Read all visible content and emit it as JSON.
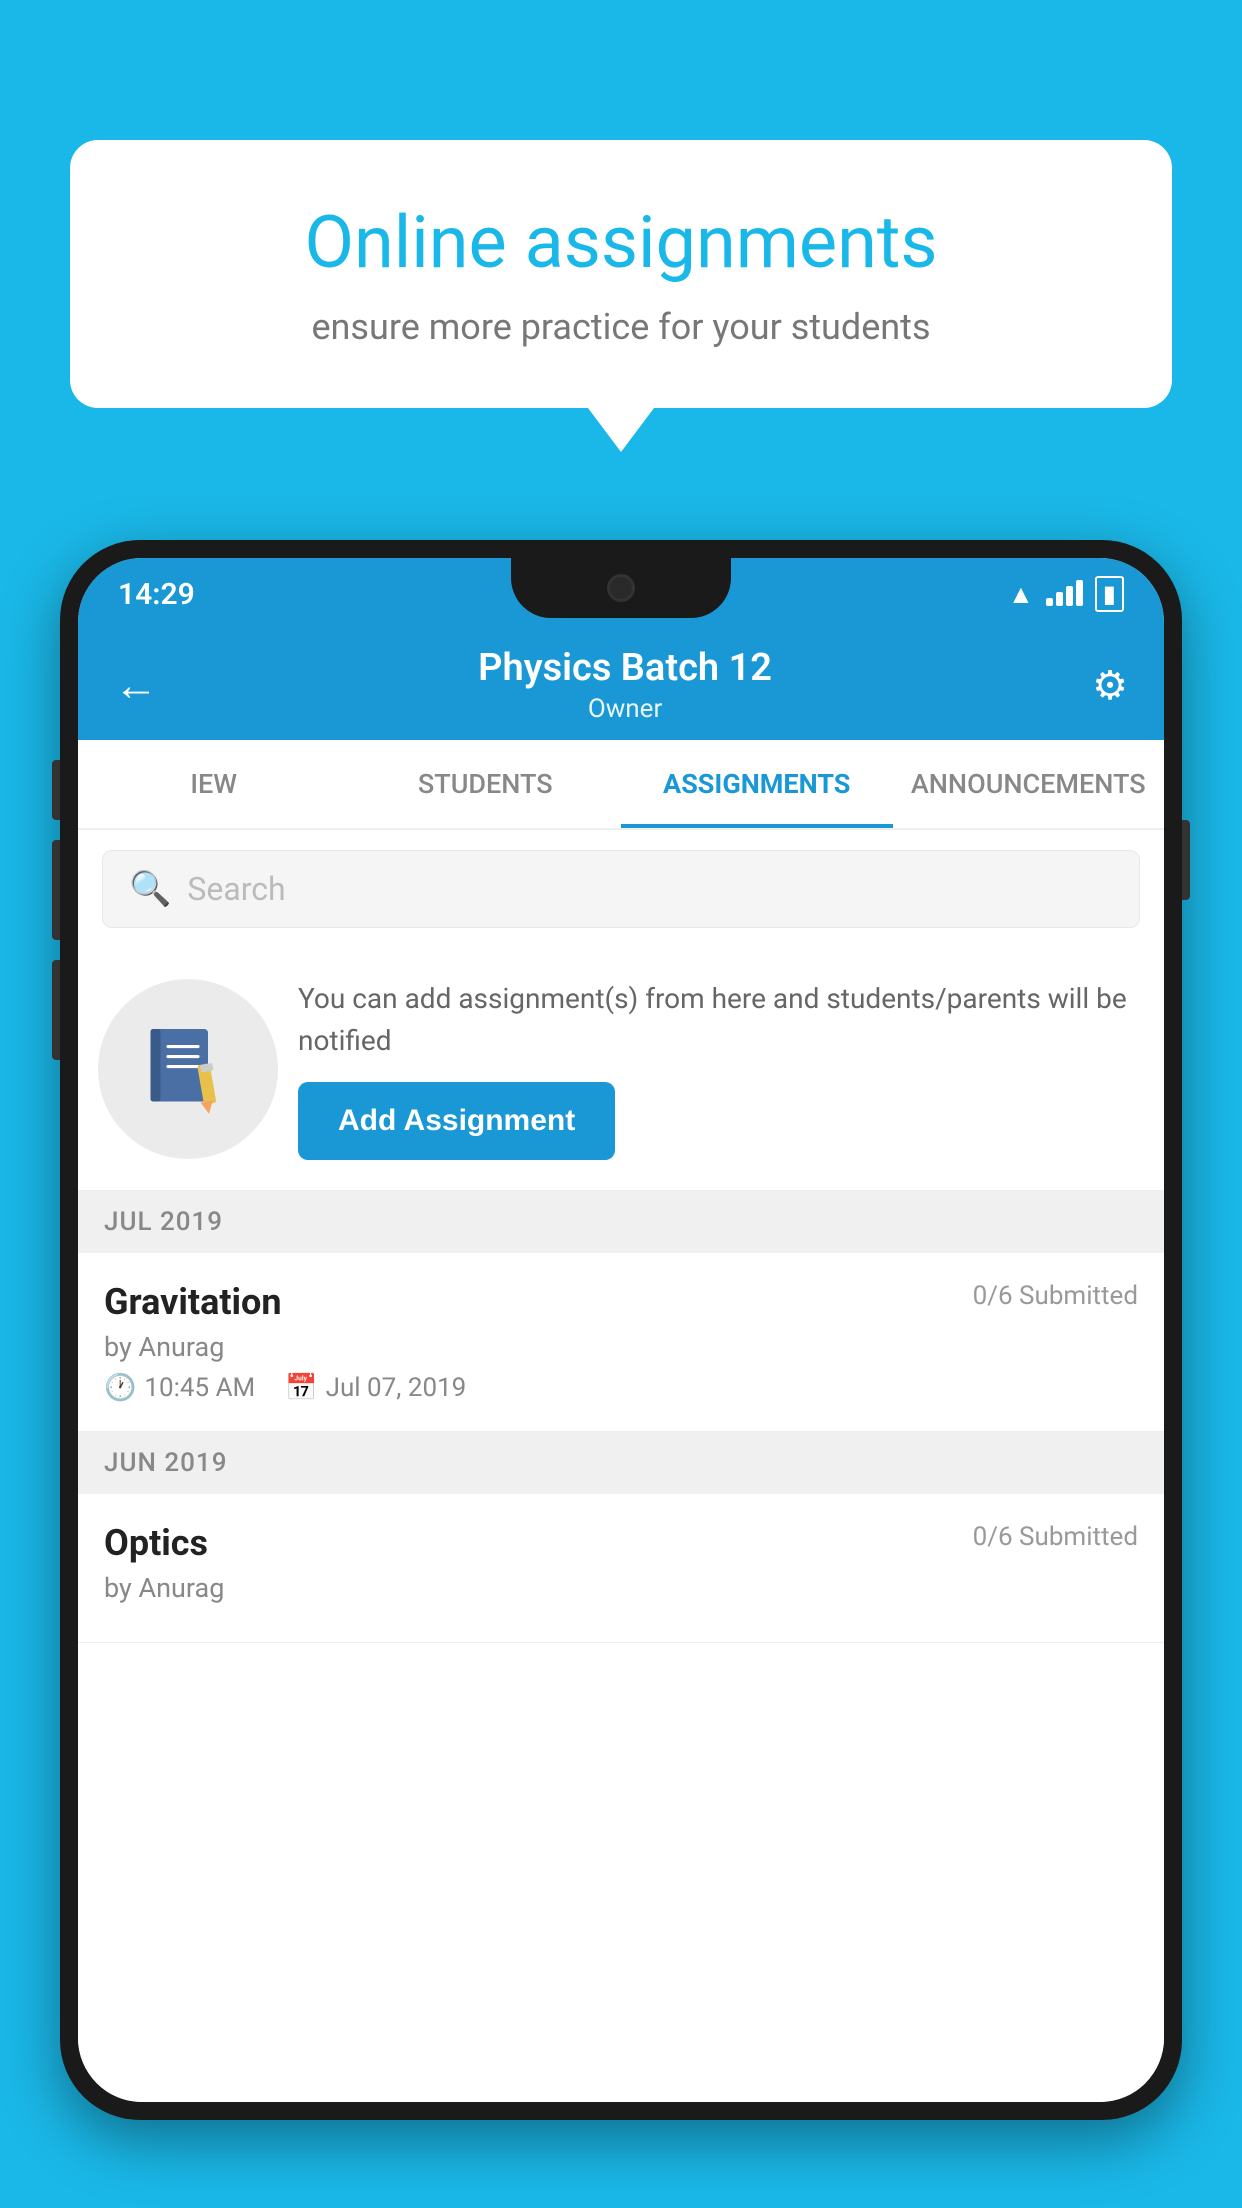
{
  "background_color": "#1ab8e8",
  "promo": {
    "headline": "Online assignments",
    "subtext": "ensure more practice for your students"
  },
  "phone": {
    "status_bar": {
      "time": "14:29",
      "wifi": "▲",
      "battery": "▮"
    },
    "header": {
      "title": "Physics Batch 12",
      "subtitle": "Owner",
      "back_label": "←",
      "settings_label": "⚙"
    },
    "tabs": [
      {
        "label": "IEW",
        "active": false
      },
      {
        "label": "STUDENTS",
        "active": false
      },
      {
        "label": "ASSIGNMENTS",
        "active": true
      },
      {
        "label": "ANNOUNCEMENTS",
        "active": false
      }
    ],
    "search": {
      "placeholder": "Search"
    },
    "add_assignment_promo": {
      "description": "You can add assignment(s) from here and students/parents will be notified",
      "button_label": "Add Assignment"
    },
    "assignments": [
      {
        "section": "JUL 2019",
        "items": [
          {
            "name": "Gravitation",
            "status": "0/6 Submitted",
            "author": "by Anurag",
            "time": "10:45 AM",
            "date": "Jul 07, 2019"
          }
        ]
      },
      {
        "section": "JUN 2019",
        "items": [
          {
            "name": "Optics",
            "status": "0/6 Submitted",
            "author": "by Anurag",
            "time": "",
            "date": ""
          }
        ]
      }
    ]
  }
}
